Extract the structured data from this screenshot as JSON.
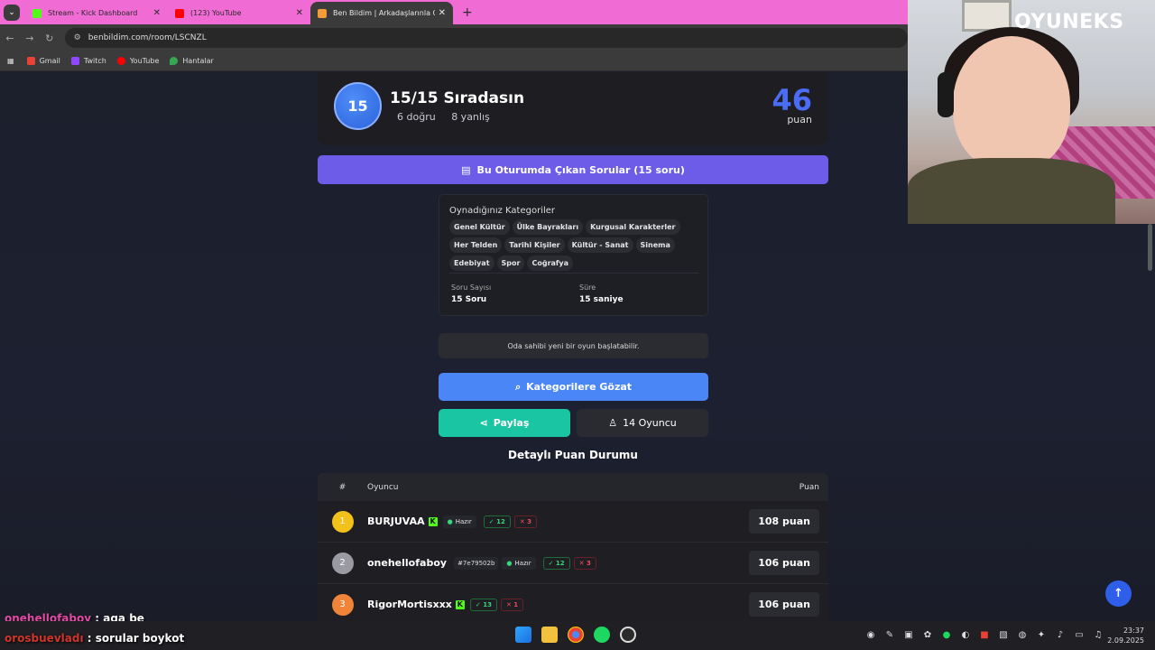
{
  "browser": {
    "tabs": [
      {
        "label": "Stream - Kick Dashboard",
        "color": "#53fc18"
      },
      {
        "label": "(123) YouTube",
        "color": "#ff0000"
      },
      {
        "label": "Ben Bildim | Arkadaşlarınla Onl",
        "color": "#f29b38"
      }
    ],
    "url": "benbildim.com/room/LSCNZL",
    "bookmarks": [
      "Gmail",
      "Twitch",
      "YouTube",
      "Hantalar"
    ]
  },
  "rank": {
    "position": "15",
    "title": "15/15 Sıradasın",
    "correct": "6 doğru",
    "wrong": "8 yanlış",
    "score": "46",
    "score_label": "puan"
  },
  "questions_button": "Bu Oturumda Çıkan Sorular (15 soru)",
  "categories": {
    "title": "Oynadığınız Kategoriler",
    "chips": [
      "Genel Kültür",
      "Ülke Bayrakları",
      "Kurgusal Karakterler",
      "Her Telden",
      "Tarihi Kişiler",
      "Kültür - Sanat",
      "Sinema",
      "Edebiyat",
      "Spor",
      "Coğrafya"
    ],
    "question_count_label": "Soru Sayısı",
    "question_count_value": "15 Soru",
    "duration_label": "Süre",
    "duration_value": "15 saniye"
  },
  "info_text": "Oda sahibi yeni bir oyun başlatabilir.",
  "buttons": {
    "browse": "Kategorilere Gözat",
    "share": "Paylaş",
    "players": "14 Oyuncu"
  },
  "leaderboard": {
    "title": "Detaylı Puan Durumu",
    "headers": {
      "num": "#",
      "player": "Oyuncu",
      "score": "Puan"
    },
    "rows": [
      {
        "rank": "1",
        "name": "BURJUVAA",
        "hash": "",
        "ready": "Hazır",
        "correct": "12",
        "wrong": "3",
        "score": "108 puan",
        "color": "#f2c21a"
      },
      {
        "rank": "2",
        "name": "onehellofaboy",
        "hash": "#7e79502b",
        "ready": "Hazır",
        "correct": "12",
        "wrong": "3",
        "score": "106 puan",
        "color": "#9a9aa2"
      },
      {
        "rank": "3",
        "name": "RigorMortisxxx",
        "hash": "",
        "ready": "",
        "correct": "13",
        "wrong": "1",
        "score": "106 puan",
        "color": "#f0853a"
      }
    ]
  },
  "overlay": {
    "logo": "OYUNEKS",
    "chat": [
      {
        "user": "onehellofaboy",
        "message": ": aga be"
      },
      {
        "user": "orosbuevladı",
        "message": ": sorular boykot"
      }
    ]
  },
  "taskbar": {
    "time": "23:37",
    "date": "2.09.2025"
  }
}
